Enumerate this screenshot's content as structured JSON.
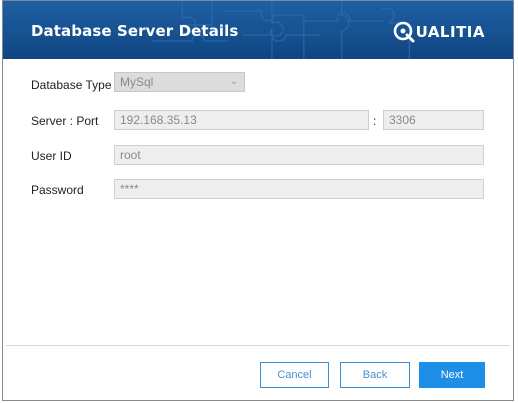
{
  "dialog": {
    "title": "Database Server Details",
    "logo_text": "UALITIA"
  },
  "form": {
    "database_type": {
      "label": "Database Type",
      "value": "MySql"
    },
    "server_port": {
      "label": "Server : Port",
      "server_value": "192.168.35.13",
      "separator": ":",
      "port_value": "3306"
    },
    "user_id": {
      "label": "User ID",
      "value": "root"
    },
    "password": {
      "label": "Password",
      "value": "****"
    }
  },
  "buttons": {
    "cancel": "Cancel",
    "back": "Back",
    "next": "Next"
  },
  "colors": {
    "header": "#16508f",
    "primary": "#1e8fe6",
    "outline": "#3b8fd8"
  }
}
